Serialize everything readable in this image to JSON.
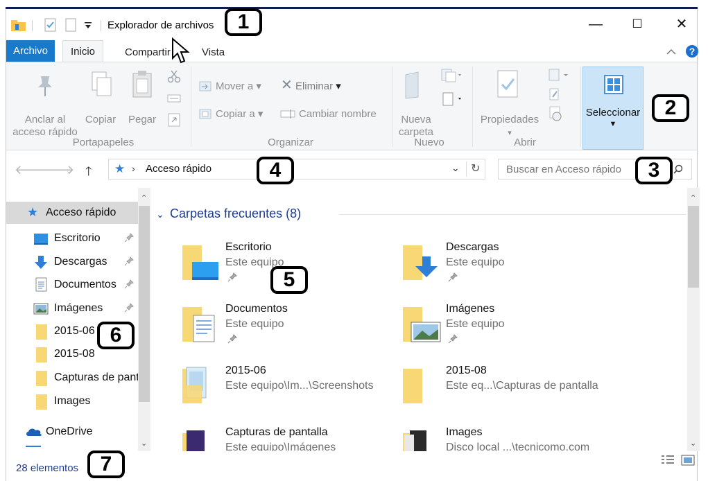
{
  "window": {
    "title": "Explorador de archivos",
    "controls": {
      "minimize": "—",
      "maximize": "☐",
      "close": "✕"
    }
  },
  "tabs": {
    "file": "Archivo",
    "home": "Inicio",
    "share": "Compartir",
    "view": "Vista"
  },
  "ribbon": {
    "pin_line1": "Anclar al",
    "pin_line2": "acceso rápido",
    "copy": "Copiar",
    "paste": "Pegar",
    "move_to": "Mover a",
    "copy_to": "Copiar a",
    "delete": "Eliminar",
    "rename": "Cambiar nombre",
    "new_folder_line1": "Nueva",
    "new_folder_line2": "carpeta",
    "properties": "Propiedades",
    "select": "Seleccionar",
    "groups": {
      "clipboard": "Portapapeles",
      "organize": "Organizar",
      "new": "Nuevo",
      "open": "Abrir"
    }
  },
  "address": {
    "path": "Acceso rápido",
    "search_placeholder": "Buscar en Acceso rápido"
  },
  "nav": {
    "items": [
      {
        "label": "Acceso rápido"
      },
      {
        "label": "Escritorio"
      },
      {
        "label": "Descargas"
      },
      {
        "label": "Documentos"
      },
      {
        "label": "Imágenes"
      },
      {
        "label": "2015-06"
      },
      {
        "label": "2015-08"
      },
      {
        "label": "Capturas de pantalla"
      },
      {
        "label": "Images"
      },
      {
        "label": "OneDrive"
      }
    ]
  },
  "content": {
    "group_header": "Carpetas frecuentes (8)",
    "folders": [
      {
        "name": "Escritorio",
        "location": "Este equipo"
      },
      {
        "name": "Descargas",
        "location": "Este equipo"
      },
      {
        "name": "Documentos",
        "location": "Este equipo"
      },
      {
        "name": "Imágenes",
        "location": "Este equipo"
      },
      {
        "name": "2015-06",
        "location": "Este equipo\\Im...\\Screenshots"
      },
      {
        "name": "2015-08",
        "location": "Este eq...\\Capturas de pantalla"
      },
      {
        "name": "Capturas de pantalla",
        "location": "Este equipo\\Imágenes"
      },
      {
        "name": "Images",
        "location": "Disco local ...\\tecnicomo.com"
      }
    ]
  },
  "status": {
    "count": "28 elementos"
  },
  "callouts": [
    "1",
    "2",
    "3",
    "4",
    "5",
    "6",
    "7"
  ],
  "colors": {
    "accent": "#1979ca",
    "folder": "#f8d775",
    "link": "#1e3c8c",
    "selection": "#cce4f7"
  }
}
